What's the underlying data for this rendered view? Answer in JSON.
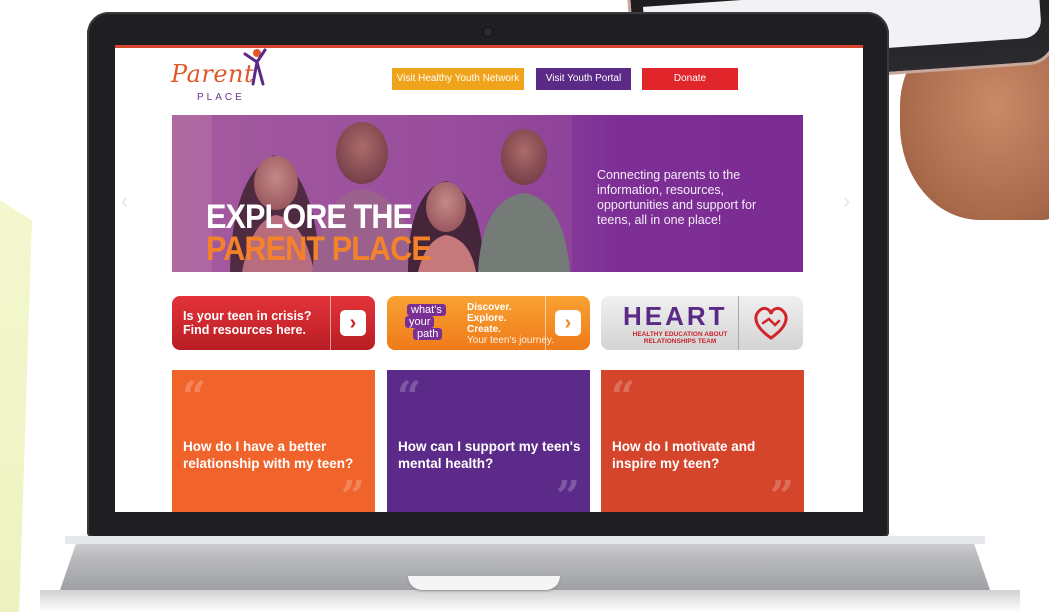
{
  "header": {
    "logo_word": "Parent",
    "logo_sub": "PLACE",
    "buttons": [
      {
        "label": "Visit Healthy Youth Network",
        "color": "#f0a41c"
      },
      {
        "label": "Visit Youth Portal",
        "color": "#5b2a86"
      },
      {
        "label": "Donate",
        "color": "#e0252b"
      }
    ]
  },
  "hero": {
    "title_line1": "EXPLORE THE",
    "title_line2": "PARENT PLACE",
    "tagline": "Connecting parents to the information, resources, opportunities and support for teens, all in one place!",
    "prev_arrow": "‹",
    "next_arrow": "›"
  },
  "promos": {
    "crisis": {
      "line1": "Is your teen in crisis?",
      "line2": "Find resources here.",
      "chevron": "›"
    },
    "path": {
      "badge": [
        "what's",
        "your",
        "path"
      ],
      "lines": [
        "Discover.",
        "Explore.",
        "Create."
      ],
      "sub": "Your teen's journey.",
      "chevron": "›"
    },
    "heart": {
      "word": "HEART",
      "sub_line1": "HEALTHY EDUCATION ABOUT",
      "sub_line2": "RELATIONSHIPS TEAM"
    }
  },
  "cards": [
    {
      "question": "How do I have a better relationship with my teen?",
      "color": "#f0632a"
    },
    {
      "question": "How can I support my teen's mental health?",
      "color": "#5c2a88"
    },
    {
      "question": "How do I motivate and inspire my teen?",
      "color": "#d5452c"
    }
  ],
  "quote_open": "“",
  "quote_close": "”",
  "icons": [
    "heart-hands-icon",
    "chevron-right-icon",
    "person-logo-icon"
  ]
}
